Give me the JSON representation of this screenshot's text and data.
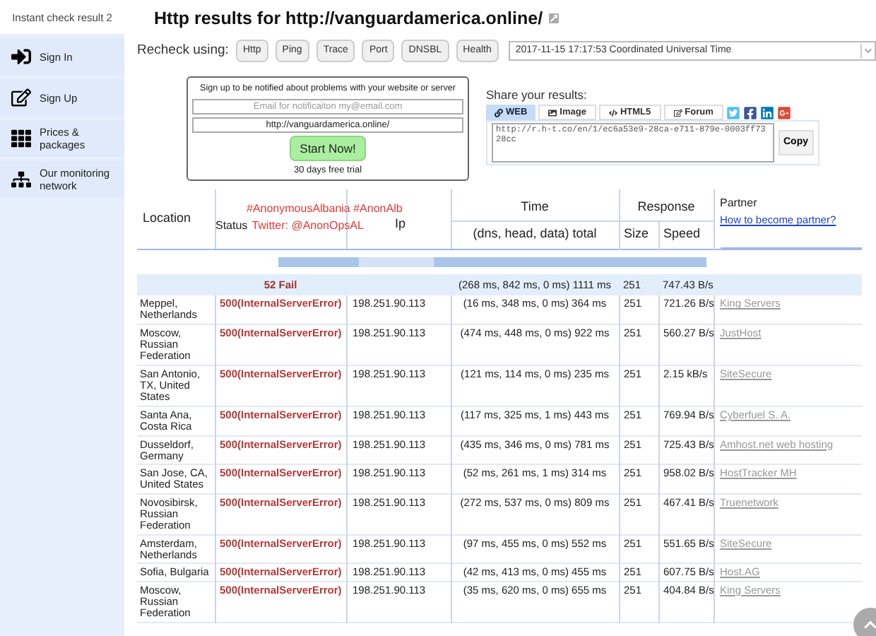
{
  "sidebar": {
    "items": [
      {
        "label": "Instant check result 2",
        "selected": true
      },
      {
        "label": "Sign In",
        "selected": false
      },
      {
        "label": "Sign Up",
        "selected": false
      },
      {
        "label": "Prices & packages",
        "selected": false
      },
      {
        "label": "Our monitoring network",
        "selected": false
      }
    ]
  },
  "title": "Http results for http://vanguardamerica.online/",
  "recheck": {
    "label": "Recheck using:",
    "buttons": [
      "Http",
      "Ping",
      "Trace",
      "Port",
      "DNSBL",
      "Health"
    ],
    "date_select": "2017-11-15 17:17:53 Coordinated Universal Time"
  },
  "signup_box": {
    "text": "Sign up to be notified about problems with your website or server",
    "email_placeholder": "Email for notificaiton my@email.com",
    "url_value": "http://vanguardamerica.online/",
    "button": "Start Now!",
    "note": "30 days free trial"
  },
  "share": {
    "label": "Share your results:",
    "tabs": [
      {
        "label": "WEB",
        "selected": true
      },
      {
        "label": "Image",
        "selected": false
      },
      {
        "label": "HTML5",
        "selected": false
      },
      {
        "label": "Forum",
        "selected": false
      }
    ],
    "link": "http://r.h-t.co/en/1/ec6a53e9-28ca-e711-879e-0003ff7328cc",
    "copy_button": "Copy"
  },
  "overlay": {
    "line_1": "#AnonymousAlbania #AnonAlb",
    "line_2": "Twitter: @AnonOpsAL"
  },
  "table": {
    "columns": {
      "location": "Location",
      "status": "Status",
      "ip": "Ip",
      "time": "Time",
      "time_sub": "(dns, head, data) total",
      "response": "Response",
      "size": "Size",
      "speed": "Speed",
      "partner": "Partner",
      "partner_link": "How to become partner?"
    },
    "summary": {
      "status": "52 Fail",
      "time": "(268 ms, 842 ms, 0 ms) 1111 ms",
      "size": "251",
      "speed": "747.43 B/s"
    },
    "rows": [
      {
        "location": "Meppel, Netherlands",
        "status": "500(InternalServerError)",
        "ip": "198.251.90.113",
        "time": "(16 ms, 348 ms, 0 ms) 364 ms",
        "size": "251",
        "speed": "721.26 B/s",
        "partner": "King Servers"
      },
      {
        "location": "Moscow, Russian Federation",
        "status": "500(InternalServerError)",
        "ip": "198.251.90.113",
        "time": "(474 ms, 448 ms, 0 ms) 922 ms",
        "size": "251",
        "speed": "560.27 B/s",
        "partner": "JustHost"
      },
      {
        "location": "San Antonio, TX, United States",
        "status": "500(InternalServerError)",
        "ip": "198.251.90.113",
        "time": "(121 ms, 114 ms, 0 ms) 235 ms",
        "size": "251",
        "speed": "2.15 kB/s",
        "partner": "SiteSecure"
      },
      {
        "location": "Santa Ana, Costa Rica",
        "status": "500(InternalServerError)",
        "ip": "198.251.90.113",
        "time": "(117 ms, 325 ms, 1 ms) 443 ms",
        "size": "251",
        "speed": "769.94 B/s",
        "partner": "Cyberfuel S. A."
      },
      {
        "location": "Dusseldorf, Germany",
        "status": "500(InternalServerError)",
        "ip": "198.251.90.113",
        "time": "(435 ms, 346 ms, 0 ms) 781 ms",
        "size": "251",
        "speed": "725.43 B/s",
        "partner": "Amhost.net web hosting"
      },
      {
        "location": "San Jose, CA, United States",
        "status": "500(InternalServerError)",
        "ip": "198.251.90.113",
        "time": "(52 ms, 261 ms, 1 ms) 314 ms",
        "size": "251",
        "speed": "958.02 B/s",
        "partner": "HostTracker MH"
      },
      {
        "location": "Novosibirsk, Russian Federation",
        "status": "500(InternalServerError)",
        "ip": "198.251.90.113",
        "time": "(272 ms, 537 ms, 0 ms) 809 ms",
        "size": "251",
        "speed": "467.41 B/s",
        "partner": "Truenetwork"
      },
      {
        "location": "Amsterdam, Netherlands",
        "status": "500(InternalServerError)",
        "ip": "198.251.90.113",
        "time": "(97 ms, 455 ms, 0 ms) 552 ms",
        "size": "251",
        "speed": "551.65 B/s",
        "partner": "SiteSecure"
      },
      {
        "location": "Sofia, Bulgaria",
        "status": "500(InternalServerError)",
        "ip": "198.251.90.113",
        "time": "(42 ms, 413 ms, 0 ms) 455 ms",
        "size": "251",
        "speed": "607.75 B/s",
        "partner": "Host.AG"
      },
      {
        "location": "Moscow, Russian Federation",
        "status": "500(InternalServerError)",
        "ip": "198.251.90.113",
        "time": "(35 ms, 620 ms, 0 ms) 655 ms",
        "size": "251",
        "speed": "404.84 B/s",
        "partner": "King Servers"
      }
    ]
  }
}
